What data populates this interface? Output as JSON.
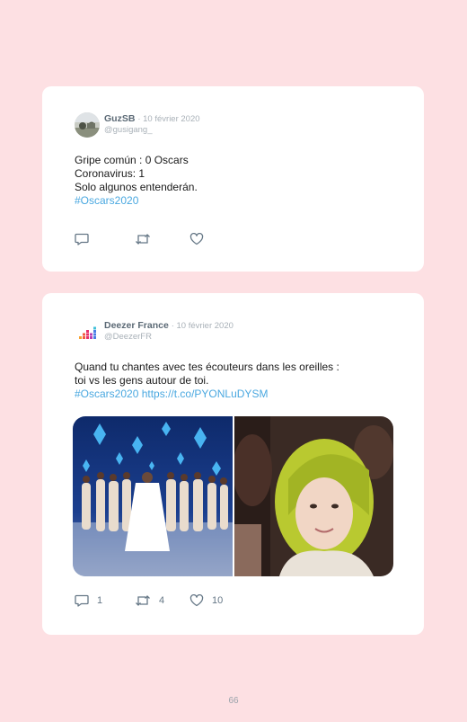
{
  "tweets": [
    {
      "name": "GuzSB",
      "date": "· 10 février 2020",
      "handle": "@gusigang_",
      "lines": [
        "Gripe común : 0 Oscars",
        "Coronavirus: 1",
        "Solo algunos entenderán."
      ],
      "hashtag": "#Oscars2020",
      "icons": [
        "reply-icon",
        "retweet-icon",
        "like-icon"
      ]
    },
    {
      "name": "Deezer France",
      "date": "· 10 février 2020",
      "handle": "@DeezerFR",
      "lines": [
        "Quand tu chantes avec tes écouteurs dans les oreilles :",
        "toi vs les gens autour de toi."
      ],
      "hashtag": "#Oscars2020",
      "link": "https://t.co/PYONLuDYSM",
      "replies": "1",
      "retweets": "4",
      "likes": "10",
      "icons": [
        "reply-icon",
        "retweet-icon",
        "like-icon"
      ]
    }
  ],
  "page_number": "66",
  "colors": {
    "background": "#fde0e3",
    "card": "#ffffff",
    "link": "#4aa8e0",
    "name": "#5b6975",
    "meta": "#a9b1b8",
    "icon": "#657786"
  }
}
